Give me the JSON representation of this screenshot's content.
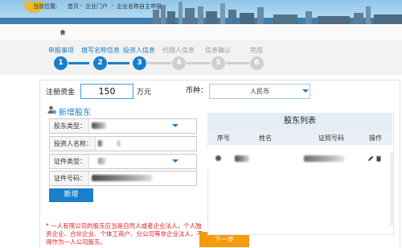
{
  "breadcrumb": {
    "prefix": "当前位置:",
    "items": [
      "首页",
      "企业门户",
      "企业名称自主申报"
    ],
    "sep": "»"
  },
  "steps": [
    {
      "number": "1",
      "label": "申报事项",
      "active": true
    },
    {
      "number": "2",
      "label": "填写名称信息",
      "active": true
    },
    {
      "number": "3",
      "label": "投资人信息",
      "active": true
    },
    {
      "number": "4",
      "label": "代理人信息",
      "active": false
    },
    {
      "number": "5",
      "label": "信息确认",
      "active": false
    },
    {
      "number": "6",
      "label": "完成",
      "active": false
    }
  ],
  "form": {
    "capital_label": "注册资金",
    "capital_value": "150",
    "capital_unit": "万元",
    "currency_label": "币种：",
    "currency_value": "人民币",
    "add_shareholder_title": "新增股东",
    "fields": [
      {
        "label": "股东类型：",
        "value": "",
        "has_dropdown": true
      },
      {
        "label": "投资人名称：",
        "value": "",
        "has_dropdown": false
      },
      {
        "label": "证件类型：",
        "value": "",
        "has_dropdown": true
      },
      {
        "label": "证件号码：",
        "value": "",
        "has_dropdown": false
      }
    ],
    "add_button": "新增"
  },
  "table": {
    "title": "股东列表",
    "columns": [
      "序号",
      "姓名",
      "证照号码",
      "操作"
    ]
  },
  "note": "* 一人有限公司的股东应当是自然人或者企业法人，个人独资企业、合伙企业、个体工商户、分公司等非企业法人，不得作为一人公司股东。",
  "next_button": "下一步",
  "colors": {
    "accent": "#1a7fc9",
    "inactive": "#cfcfcf",
    "next": "#f59b0c",
    "note": "#e02020"
  }
}
